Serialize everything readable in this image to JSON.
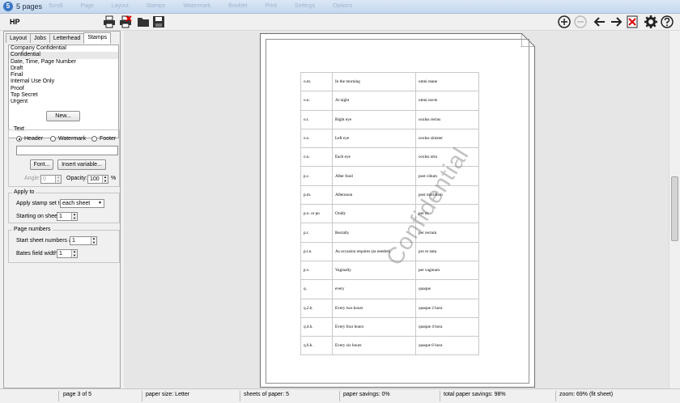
{
  "window": {
    "title": "5 pages"
  },
  "menu_ghost": "Scroll  Page Layout  Stamps  Watermark  Booklet  Print  Settings  Options",
  "toolbar": {
    "printer": "HP",
    "buttons": [
      "printer-icon",
      "printer-delete-icon",
      "folder-icon",
      "save-icon",
      "zoom-in-icon",
      "zoom-out-icon",
      "arrow-left-icon",
      "arrow-right-icon",
      "close-icon",
      "gear-icon",
      "help-icon"
    ]
  },
  "tabs": [
    {
      "label": "Layout",
      "active": false
    },
    {
      "label": "Jobs",
      "active": false
    },
    {
      "label": "Letterhead",
      "active": false
    },
    {
      "label": "Stamps",
      "active": true
    }
  ],
  "stamps": {
    "items": [
      "Company Confidential",
      "Confidential",
      "Date, Time, Page Number",
      "Draft",
      "Final",
      "Internal Use Only",
      "Proof",
      "Top Secret",
      "Urgent"
    ],
    "selected_index": 1,
    "new_button": "New..."
  },
  "text_group": {
    "label": "Text",
    "radios": [
      {
        "label": "Header",
        "checked": true
      },
      {
        "label": "Watermark",
        "checked": false
      },
      {
        "label": "Footer",
        "checked": false
      }
    ],
    "input_value": "",
    "font_button": "Font...",
    "insert_button": "Insert variable...",
    "angle_label": "Angle:",
    "angle_value": "0",
    "opacity_label": "Opacity:",
    "opacity_value": "100",
    "opacity_unit": "%"
  },
  "apply_group": {
    "label": "Apply to",
    "apply_label": "Apply stamp set to",
    "apply_value": "each sheet",
    "start_label": "Starting on sheet",
    "start_value": "1"
  },
  "page_numbers_group": {
    "label": "Page numbers",
    "start_label": "Start sheet numbers at",
    "start_value": "1",
    "bates_label": "Bates field width:",
    "bates_value": "1"
  },
  "document": {
    "watermark": "Confidential",
    "rows": [
      [
        "o.m.",
        "In the morning",
        "omni mane"
      ],
      [
        "o.n.",
        "At night",
        "omni nocte"
      ],
      [
        "o.r.",
        "Right eye",
        "oculus rectus"
      ],
      [
        "o.s.",
        "Left eye",
        "oculus sinister"
      ],
      [
        "o.u.",
        "Each eye",
        "oculus utro"
      ],
      [
        "p.c.",
        "After food",
        "post cibum"
      ],
      [
        "p.m.",
        "Afternoon",
        "post meridiem"
      ],
      [
        "p.o. or po",
        "Orally",
        "per os"
      ],
      [
        "p.r.",
        "Rectally",
        "per rectum"
      ],
      [
        "p.r.n.",
        "As occasion requires (as needed)",
        "pro re nata"
      ],
      [
        "p.v.",
        "Vaginally",
        "per vaginum"
      ],
      [
        "q.",
        "every",
        "quaque"
      ],
      [
        "q.2.h.",
        "Every two hours",
        "quaque 2 hora"
      ],
      [
        "q.4.h.",
        "Every four hours",
        "quaque 4 hora"
      ],
      [
        "q.6.h.",
        "Every six hours",
        "quaque 6 hora"
      ]
    ]
  },
  "status": {
    "page": "page 3 of 5",
    "paper_size": "paper size: Letter",
    "sheets": "sheets of paper: 5",
    "savings": "paper savings: 0%",
    "total_savings": "total paper savings: 98%",
    "zoom": "zoom: 69% (fit sheet)"
  }
}
